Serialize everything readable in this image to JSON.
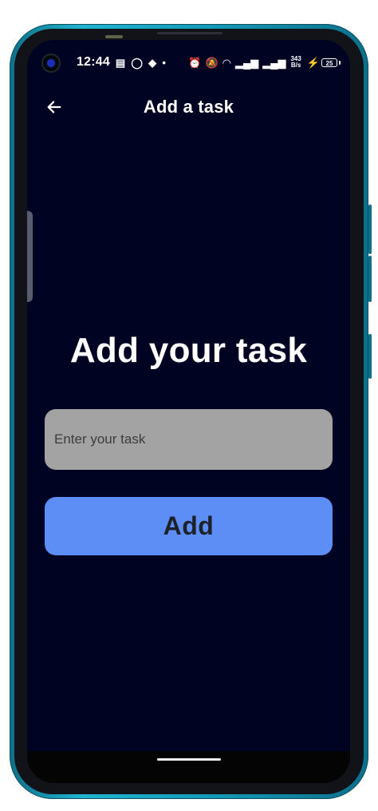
{
  "status_bar": {
    "time": "12:44",
    "network_speed_value": "343",
    "network_speed_unit": "B/s",
    "battery_level": "25",
    "left_icons": [
      "message-icon",
      "whatsapp-icon",
      "snapchat-icon",
      "dot-icon"
    ],
    "right_icons": [
      "alarm-icon",
      "mute-bell-icon",
      "wifi-icon",
      "signal-icon",
      "signal-icon",
      "charging-icon"
    ]
  },
  "app_bar": {
    "title": "Add a task",
    "back_icon": "back-arrow-icon"
  },
  "main": {
    "heading": "Add your task",
    "task_input": {
      "placeholder": "Enter your task",
      "value": ""
    },
    "add_button_label": "Add"
  },
  "colors": {
    "phone_frame": "#1fb4d0",
    "screen_background": "#000322",
    "input_background": "#a3a3a3",
    "button_background": "#5d8ef5",
    "button_text": "#1d2128",
    "text_primary": "#ffffff"
  }
}
